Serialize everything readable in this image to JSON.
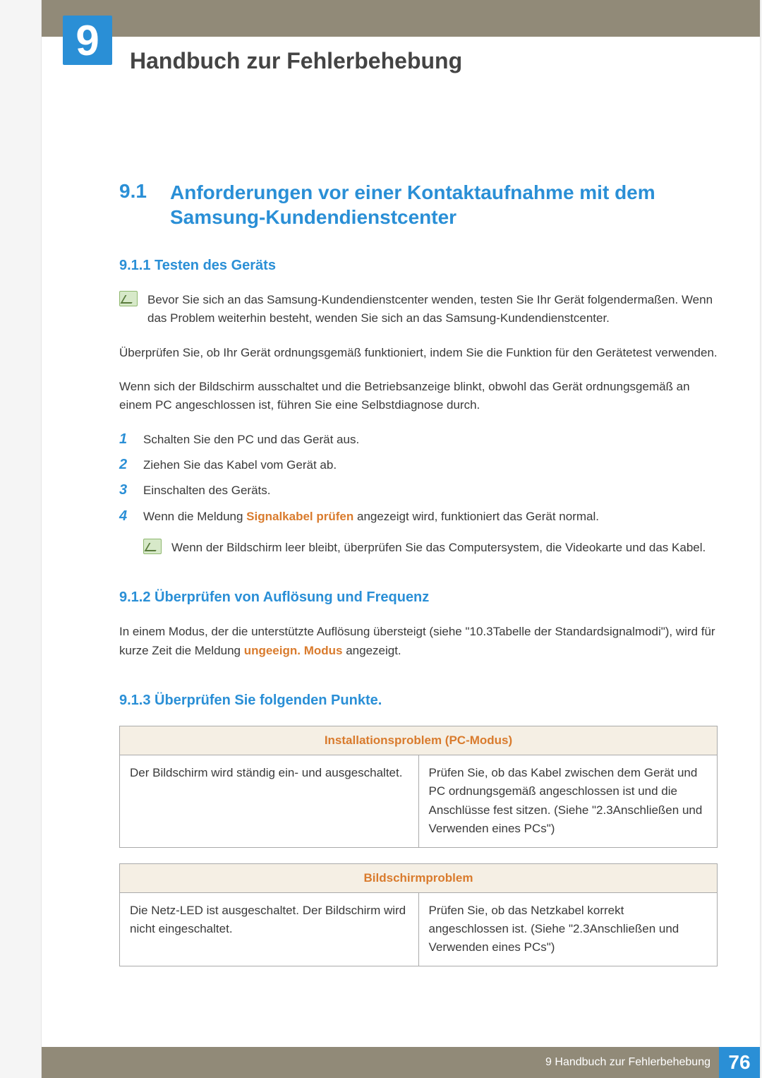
{
  "chapter": {
    "number": "9",
    "title": "Handbuch zur Fehlerbehebung"
  },
  "section": {
    "number": "9.1",
    "title": "Anforderungen vor einer Kontaktaufnahme mit dem Samsung-Kundendienstcenter"
  },
  "subsections": {
    "s911": {
      "heading": "9.1.1  Testen des Geräts",
      "note": "Bevor Sie sich an das Samsung-Kundendienstcenter wenden, testen Sie Ihr Gerät folgendermaßen. Wenn das Problem weiterhin besteht, wenden Sie sich an das Samsung-Kundendienstcenter.",
      "p1": "Überprüfen Sie, ob Ihr Gerät ordnungsgemäß funktioniert, indem Sie die Funktion für den Gerätetest verwenden.",
      "p2": "Wenn sich der Bildschirm ausschaltet und die Betriebsanzeige blinkt, obwohl das Gerät ordnungsgemäß an einem PC angeschlossen ist, führen Sie eine Selbstdiagnose durch.",
      "steps": [
        "Schalten Sie den PC und das Gerät aus.",
        "Ziehen Sie das Kabel vom Gerät ab.",
        "Einschalten des Geräts.",
        {
          "pre": "Wenn die Meldung ",
          "bold": "Signalkabel prüfen",
          "post": " angezeigt wird, funktioniert das Gerät normal."
        }
      ],
      "step_nums": [
        "1",
        "2",
        "3",
        "4"
      ],
      "note2": "Wenn der Bildschirm leer bleibt, überprüfen Sie das Computersystem, die Videokarte und das Kabel."
    },
    "s912": {
      "heading": "9.1.2  Überprüfen von Auflösung und Frequenz",
      "p_pre": "In einem Modus, der die unterstützte Auflösung übersteigt (siehe \"10.3Tabelle der Standardsignalmodi\"), wird für kurze Zeit die Meldung ",
      "p_bold": "ungeeign. Modus",
      "p_post": " angezeigt."
    },
    "s913": {
      "heading": "9.1.3  Überprüfen Sie folgenden Punkte.",
      "table1": {
        "header": "Installationsproblem (PC-Modus)",
        "row": {
          "left": "Der Bildschirm wird ständig ein- und ausgeschaltet.",
          "right": "Prüfen Sie, ob das Kabel zwischen dem Gerät und PC ordnungsgemäß angeschlossen ist und die Anschlüsse fest sitzen. (Siehe \"2.3Anschließen und Verwenden eines PCs\")"
        }
      },
      "table2": {
        "header": "Bildschirmproblem",
        "row": {
          "left": "Die Netz-LED ist ausgeschaltet. Der Bildschirm wird nicht eingeschaltet.",
          "right": "Prüfen Sie, ob das Netzkabel korrekt angeschlossen ist. (Siehe \"2.3Anschließen und Verwenden eines PCs\")"
        }
      }
    }
  },
  "footer": {
    "text": "9 Handbuch zur Fehlerbehebung",
    "page": "76"
  }
}
